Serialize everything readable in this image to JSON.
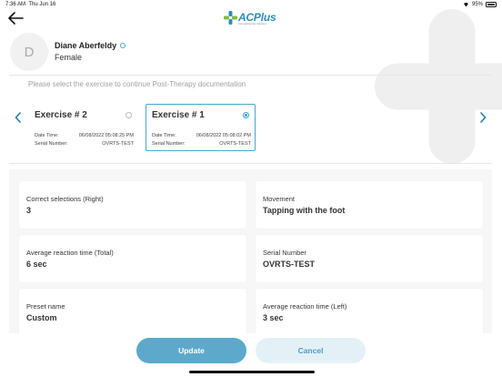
{
  "status_bar": {
    "time": "7:36 AM",
    "date": "Thu Jun 16",
    "battery": "95%"
  },
  "header": {
    "logo_text": "ACPlus",
    "logo_subtitle": "International Care Solutions"
  },
  "patient": {
    "initial": "D",
    "name": "Diane Aberfeldy",
    "gender": "Female"
  },
  "instruction": "Please select the exercise to continue Post-Therapy documentation",
  "exercises": [
    {
      "title": "Exercise # 2",
      "datetime_label": "Date Time:",
      "datetime": "06/08/2022 05:08:25 PM",
      "serial_label": "Serial Number:",
      "serial": "OVRTS-TEST",
      "selected": false
    },
    {
      "title": "Exercise # 1",
      "datetime_label": "Date Time:",
      "datetime": "06/08/2022 05:08:02 PM",
      "serial_label": "Serial Number:",
      "serial": "OVRTS-TEST",
      "selected": true
    }
  ],
  "details": [
    {
      "label": "Correct selections (Right)",
      "value": "3"
    },
    {
      "label": "Movement",
      "value": "Tapping with the foot"
    },
    {
      "label": "Average reaction time (Total)",
      "value": "6 sec"
    },
    {
      "label": "Serial Number",
      "value": "OVRTS-TEST"
    },
    {
      "label": "Preset name",
      "value": "Custom"
    },
    {
      "label": "Average reaction time (Left)",
      "value": "3 sec"
    }
  ],
  "buttons": {
    "update": "Update",
    "cancel": "Cancel"
  },
  "colors": {
    "accent": "#4aa6cf",
    "update_bg": "#5ca9cc",
    "cancel_bg": "#e3f1f6"
  },
  "icons": {
    "back": "arrow-left-icon",
    "prev": "chevron-left-icon",
    "next": "chevron-right-icon",
    "info": "info-circle-icon"
  }
}
